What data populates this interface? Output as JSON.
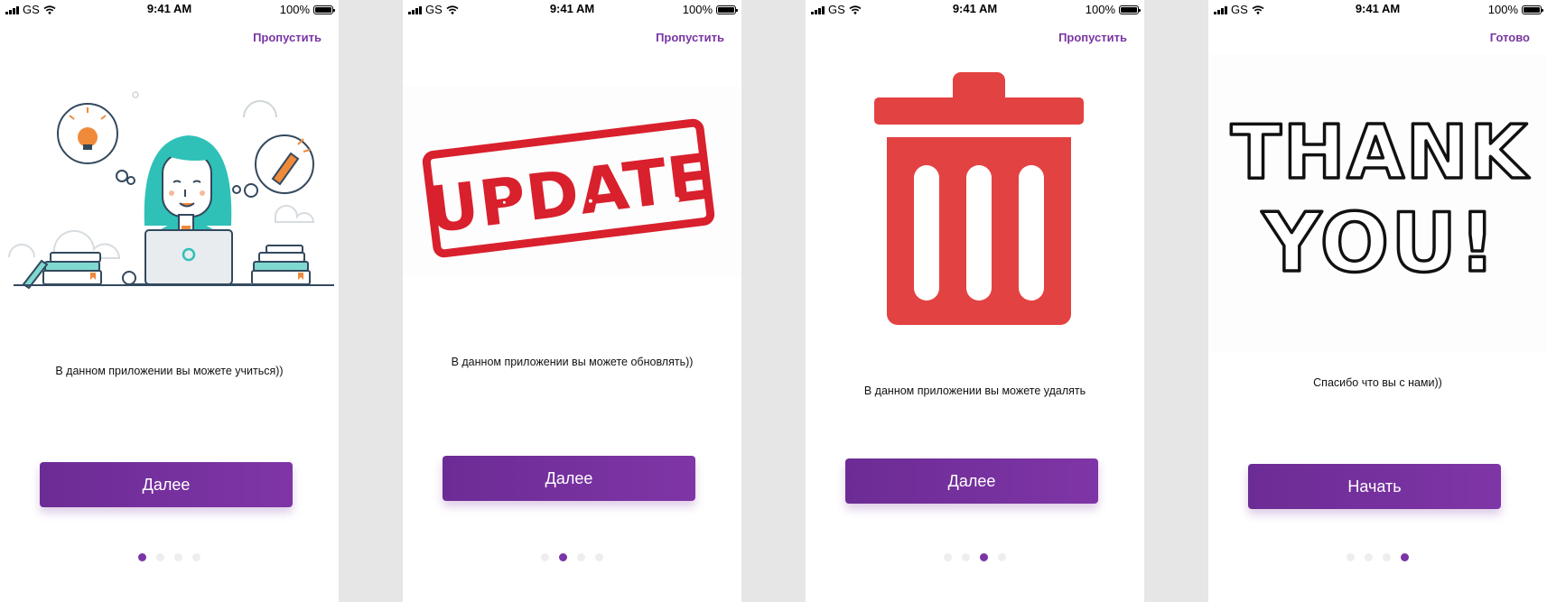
{
  "statusbar": {
    "carrier": "GS",
    "time": "9:41 AM",
    "battery": "100%"
  },
  "colors": {
    "accent": "#7a35a6",
    "trash": "#e34242",
    "stamp": "#d9202d"
  },
  "screens": [
    {
      "top_action": "Пропустить",
      "illustration": "girl-studying-laptop",
      "caption": "В данном приложении вы можете учиться))",
      "button": "Далее",
      "active_page": 1
    },
    {
      "top_action": "Пропустить",
      "illustration": "update-stamp",
      "stamp_text": "UPDATE",
      "caption": "В данном приложении вы можете обновлять))",
      "button": "Далее",
      "active_page": 2
    },
    {
      "top_action": "Пропустить",
      "illustration": "trash-can-icon",
      "caption": "В данном приложении вы можете удалять",
      "button": "Далее",
      "active_page": 3
    },
    {
      "top_action": "Готово",
      "illustration": "thank-you-lettering",
      "thank_line1": "THANK",
      "thank_line2": "YOU!",
      "caption": "Спасибо что вы с нами))",
      "button": "Начать",
      "active_page": 4
    }
  ],
  "page_count": 4
}
